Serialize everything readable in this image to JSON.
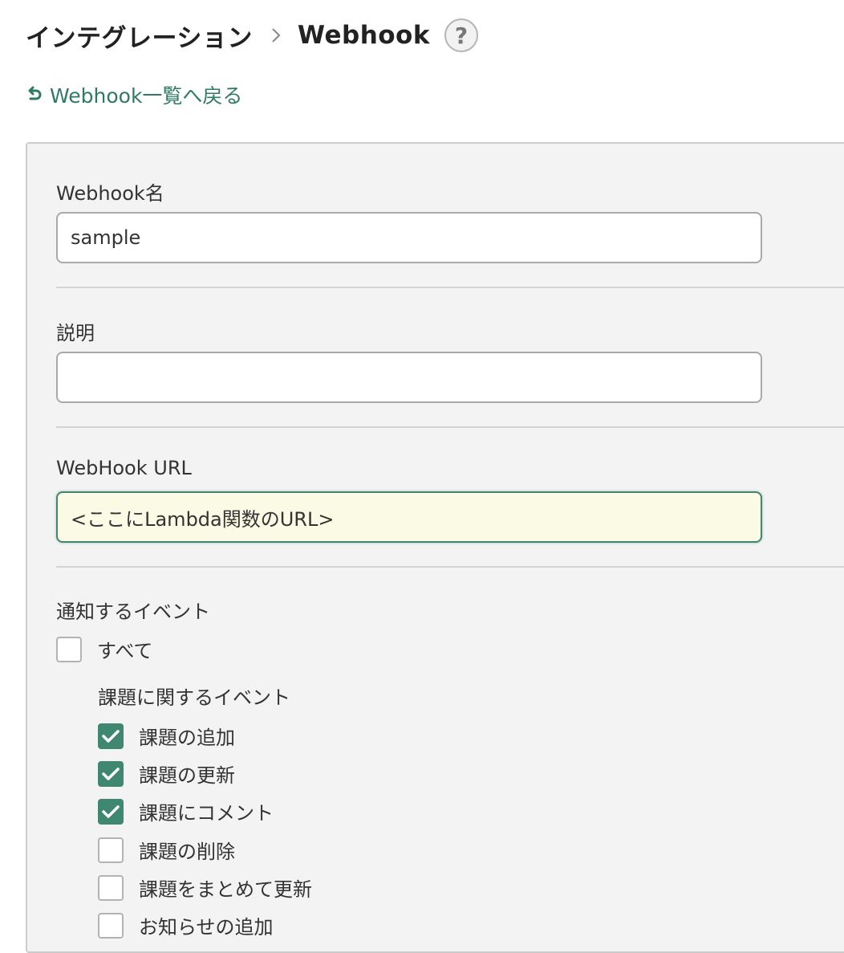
{
  "header": {
    "breadcrumb_parent": "インテグレーション",
    "breadcrumb_current": "Webhook",
    "help_icon": "question-circle-icon",
    "help_label": "?"
  },
  "back_link": {
    "icon": "undo-arrow-icon",
    "label": "Webhook一覧へ戻る",
    "color": "#2f7a65"
  },
  "form": {
    "name": {
      "label": "Webhook名",
      "value": "sample"
    },
    "description": {
      "label": "説明",
      "value": ""
    },
    "url": {
      "label": "WebHook URL",
      "value": "<ここにLambda関数のURL>"
    },
    "events": {
      "label": "通知するイベント",
      "all": {
        "label": "すべて",
        "checked": false
      },
      "issue_group_label": "課題に関するイベント",
      "items": [
        {
          "label": "課題の追加",
          "checked": true
        },
        {
          "label": "課題の更新",
          "checked": true
        },
        {
          "label": "課題にコメント",
          "checked": true
        },
        {
          "label": "課題の削除",
          "checked": false
        },
        {
          "label": "課題をまとめて更新",
          "checked": false
        },
        {
          "label": "お知らせの追加",
          "checked": false
        }
      ]
    }
  },
  "colors": {
    "accent": "#3f8770",
    "link": "#2f7a65",
    "focused_input_bg": "#fbfae5",
    "panel_bg": "#f3f3f3"
  }
}
